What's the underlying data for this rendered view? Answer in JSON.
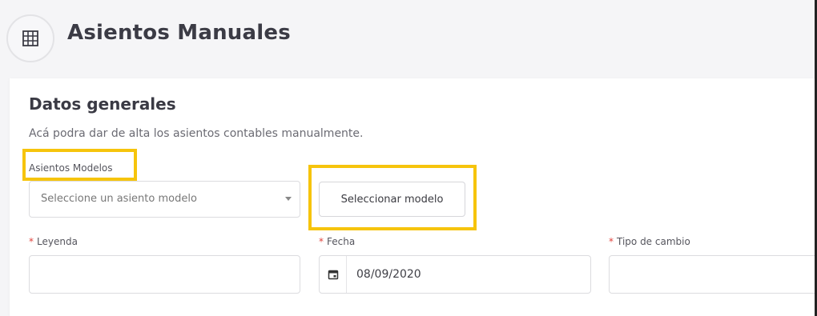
{
  "header": {
    "title": "Asientos Manuales",
    "icon": "grid-icon"
  },
  "section": {
    "title": "Datos generales",
    "description": "Acá podra dar de alta los asientos contables manualmente."
  },
  "model_select": {
    "label": "Asientos Modelos",
    "placeholder": "Seleccione un asiento modelo"
  },
  "select_model_button": {
    "label": "Seleccionar modelo"
  },
  "fields": {
    "required_marker": "*",
    "leyenda": {
      "label": "Leyenda",
      "value": ""
    },
    "fecha": {
      "label": "Fecha",
      "value": "08/09/2020",
      "icon": "calendar-icon"
    },
    "tipo_cambio": {
      "label": "Tipo de cambio",
      "value": ""
    }
  },
  "colors": {
    "highlight": "#f6c40c",
    "required": "#e0433e"
  }
}
